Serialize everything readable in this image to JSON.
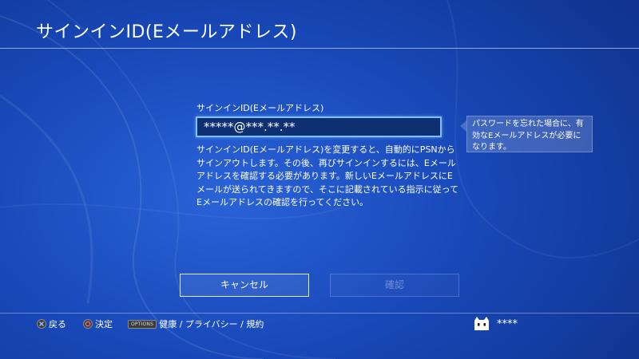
{
  "header": {
    "title": "サインインID(Eメールアドレス)"
  },
  "form": {
    "field_label": "サインインID(Eメールアドレス)",
    "field_value": "*****@***.**.**",
    "description": "サインインID(Eメールアドレス)を変更すると、自動的にPSNからサインアウトします。その後、再びサインインするには、Eメールアドレスを確認する必要があります。新しいEメールアドレスにEメールが送られてきますので、そこに記載されている指示に従ってEメールアドレスの確認を行ってください。"
  },
  "tooltip": {
    "text": "パスワードを忘れた場合に、有効なEメールアドレスが必要になります。"
  },
  "buttons": {
    "cancel": "キャンセル",
    "confirm": "確認"
  },
  "footer": {
    "back_label": "戻る",
    "enter_label": "決定",
    "options_badge": "OPTIONS",
    "health_label": "健康 / プライバシー / 規約"
  },
  "user": {
    "name": "****"
  },
  "colors": {
    "accent": "#7fc0ff",
    "background": "#1848b8"
  }
}
